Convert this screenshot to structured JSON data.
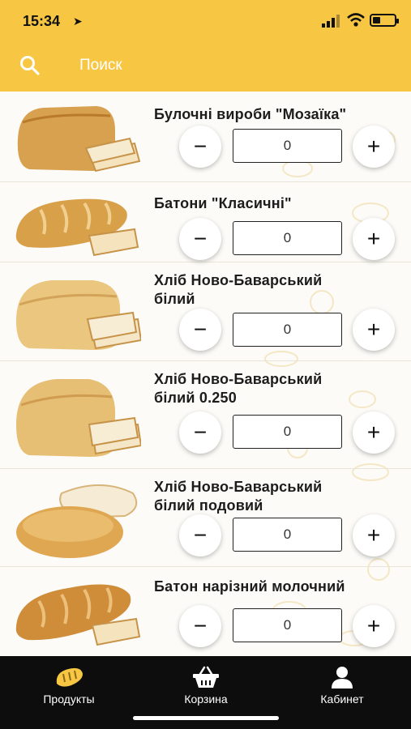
{
  "status_bar": {
    "time": "15:34"
  },
  "search": {
    "label": "Поиск"
  },
  "colors": {
    "accent": "#f7c744",
    "tabbar": "#0d0d0d"
  },
  "products": [
    {
      "name": "Булочні вироби \"Мозаїка\"",
      "qty": "0"
    },
    {
      "name": "Батони \"Класичні\"",
      "qty": "0"
    },
    {
      "name": "Хліб Ново-Баварський білий",
      "qty": "0"
    },
    {
      "name": "Хліб Ново-Баварський білий 0.250",
      "qty": "0"
    },
    {
      "name": "Хліб Ново-Баварський білий подовий",
      "qty": "0"
    },
    {
      "name": "Батон нарізний молочний",
      "qty": "0"
    }
  ],
  "controls": {
    "minus": "−",
    "plus": "+"
  },
  "tabs": [
    {
      "label": "Продукты",
      "icon": "bread-icon"
    },
    {
      "label": "Корзина",
      "icon": "basket-icon"
    },
    {
      "label": "Кабинет",
      "icon": "user-icon"
    }
  ]
}
